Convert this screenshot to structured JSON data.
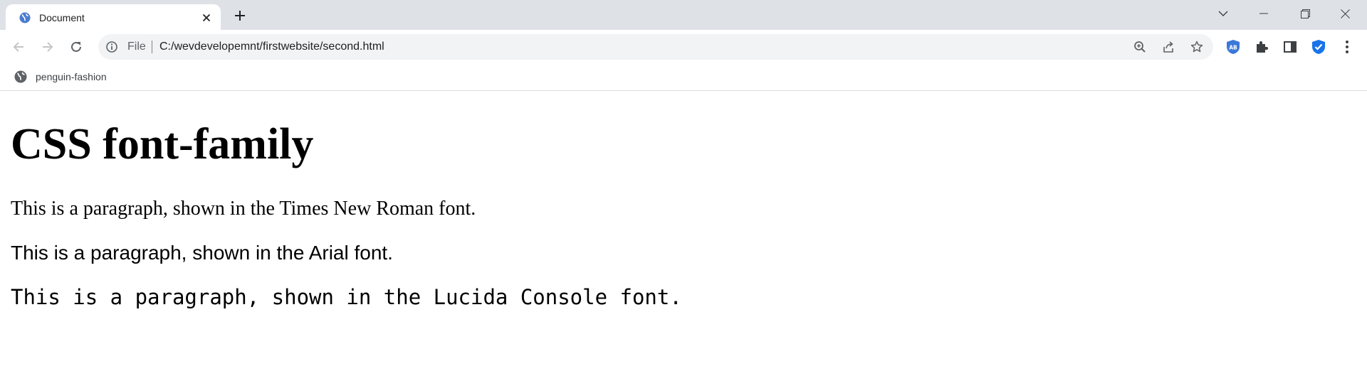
{
  "browser": {
    "tab": {
      "title": "Document",
      "favicon": "globe-icon"
    },
    "address_bar": {
      "scheme_label": "File",
      "url": "C:/wevdevelopemnt/firstwebsite/second.html"
    },
    "bookmarks": [
      {
        "label": "penguin-fashion",
        "icon": "globe-icon"
      }
    ],
    "extensions": [
      {
        "name": "adblock",
        "badge_text": "AB",
        "color": "#3c78d8"
      },
      {
        "name": "extensions-puzzle"
      },
      {
        "name": "side-panel"
      },
      {
        "name": "shield",
        "color": "#1a73e8"
      }
    ]
  },
  "page": {
    "heading": "CSS font-family",
    "paragraphs": {
      "times": "This is a paragraph, shown in the Times New Roman font.",
      "arial": "This is a paragraph, shown in the Arial font.",
      "lucida": "This is a paragraph, shown in the Lucida Console font."
    }
  }
}
